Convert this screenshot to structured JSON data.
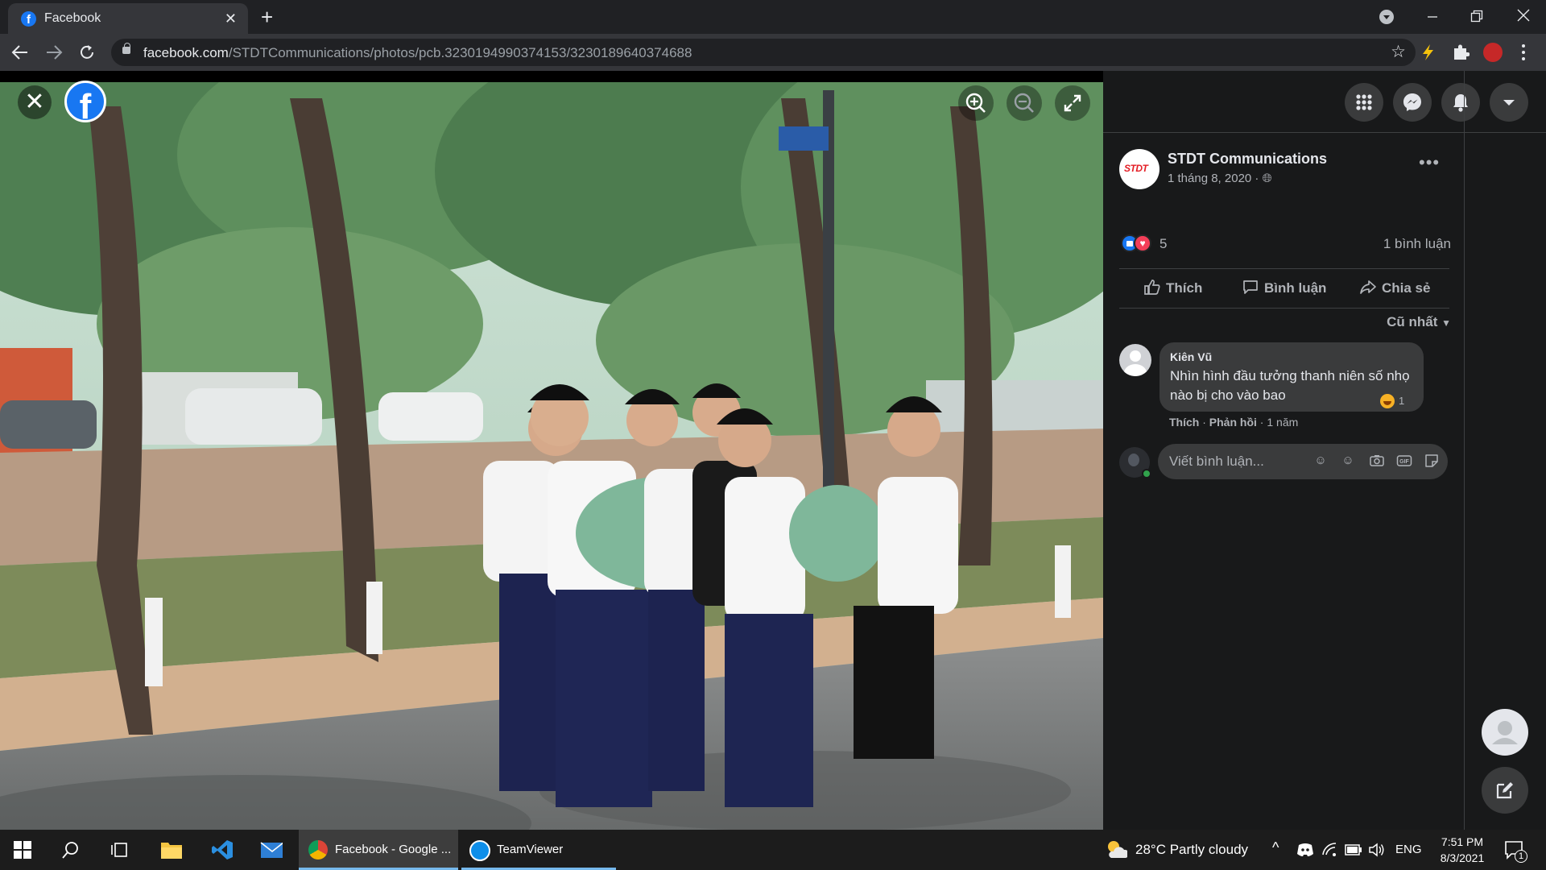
{
  "browser": {
    "tab_title": "Facebook",
    "tab_close": "✕",
    "new_tab": "+",
    "url_host": "facebook.com",
    "url_path": "/STDTCommunications/photos/pcb.3230194990374153/3230189640374688"
  },
  "viewer": {
    "close_glyph": "✕",
    "logo_letter": "f"
  },
  "post": {
    "page_name": "STDT Communications",
    "page_logo_text": "STDT",
    "date": "1 tháng 8, 2020 · ",
    "reaction_count": "5",
    "comment_count": "1 bình luận",
    "actions": {
      "like": "Thích",
      "comment": "Bình luận",
      "share": "Chia sẻ"
    },
    "sort_label": "Cũ nhất"
  },
  "comment": {
    "author": "Kiên Vũ",
    "text": "Nhìn hình đầu tưởng thanh niên số nhọ nào bị cho vào bao",
    "reaction_count": "1",
    "meta_like": "Thích",
    "meta_reply": "Phản hồi",
    "meta_time": "1 năm"
  },
  "composer": {
    "placeholder": "Viết bình luận..."
  },
  "taskbar": {
    "apps": [
      {
        "label": "Facebook - Google ..."
      },
      {
        "label": "TeamViewer"
      }
    ],
    "weather": "28°C  Partly cloudy",
    "language": "ENG",
    "time": "7:51 PM",
    "date": "8/3/2021",
    "notification_count": "1"
  },
  "colors": {
    "facebook_blue": "#1877f2",
    "sidebar_bg": "#18191a",
    "bubble_bg": "#3a3b3c",
    "text_primary": "#e4e6eb",
    "text_secondary": "#b0b3b8",
    "love_red": "#f33e58",
    "online_green": "#31a24c"
  }
}
